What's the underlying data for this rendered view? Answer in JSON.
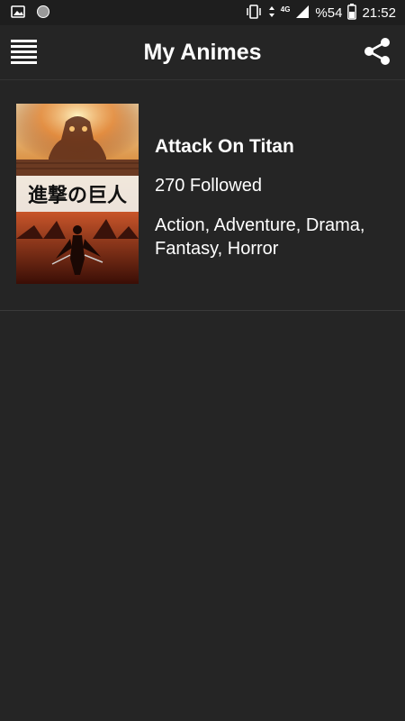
{
  "status_bar": {
    "icons_left": [
      "image-icon",
      "circle-notification-icon"
    ],
    "network": "4G",
    "battery": "%54",
    "time": "21:52"
  },
  "app_bar": {
    "title": "My Animes",
    "menu_icon": "hamburger-menu-icon",
    "share_icon": "share-icon"
  },
  "anime_list": [
    {
      "title": "Attack On Titan",
      "followed": "270 Followed",
      "genres": "Action, Adventure, Drama, Fantasy, Horror",
      "poster_text": "進撃の巨人"
    }
  ],
  "colors": {
    "background": "#252525",
    "status_bar": "#1e1e1e",
    "text": "#ffffff"
  }
}
